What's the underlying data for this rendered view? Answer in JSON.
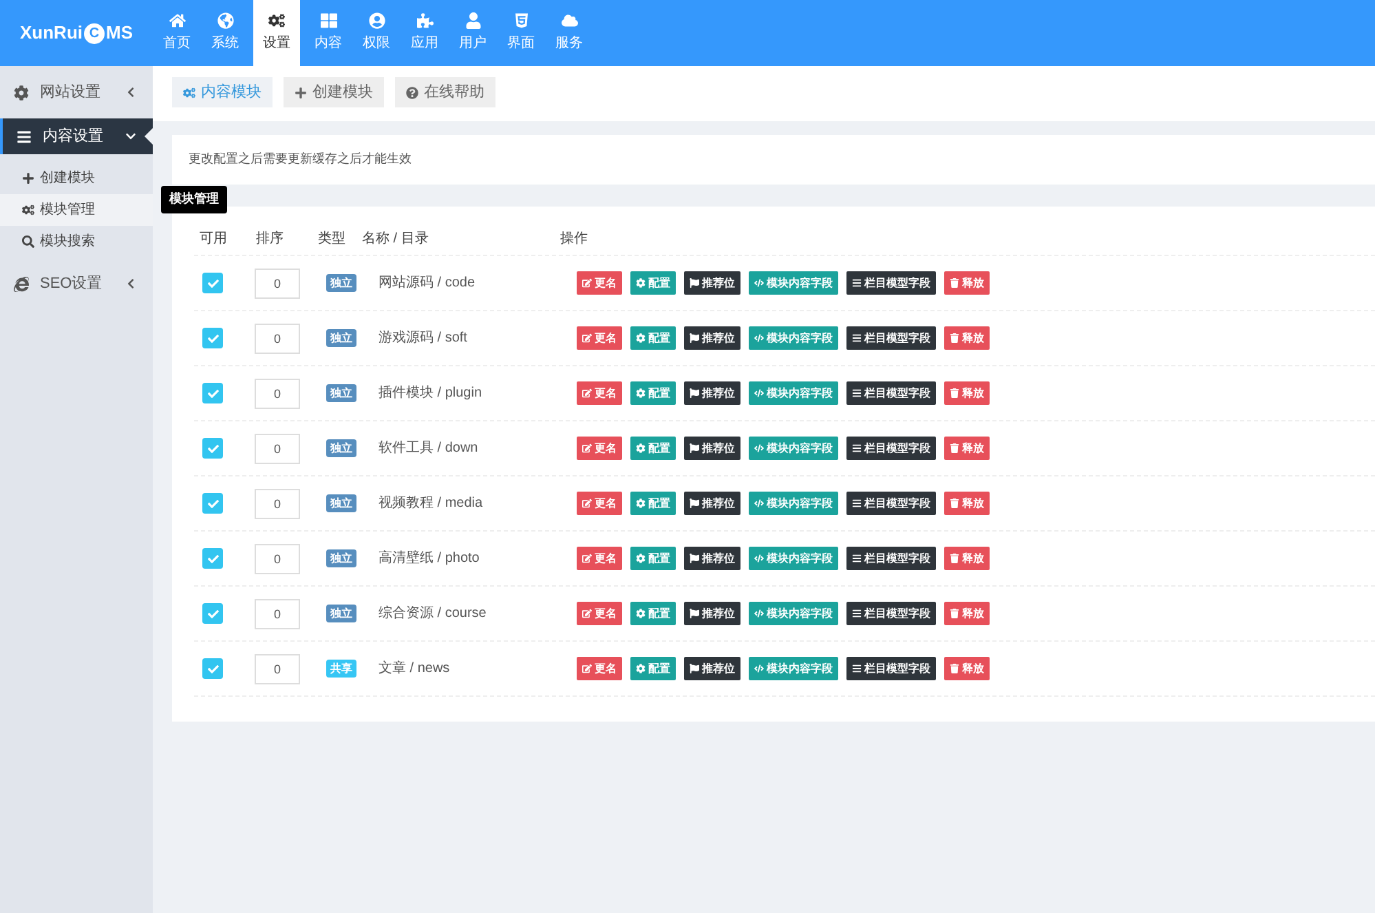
{
  "brand": {
    "name_before": "XunRui",
    "name_mark": "C",
    "name_after": "MS"
  },
  "nav": [
    {
      "label": "首页",
      "selected": false
    },
    {
      "label": "系统",
      "selected": false
    },
    {
      "label": "设置",
      "selected": true
    },
    {
      "label": "内容",
      "selected": false
    },
    {
      "label": "权限",
      "selected": false
    },
    {
      "label": "应用",
      "selected": false
    },
    {
      "label": "用户",
      "selected": false
    },
    {
      "label": "界面",
      "selected": false
    },
    {
      "label": "服务",
      "selected": false
    }
  ],
  "sidebar": {
    "items": [
      {
        "label": "网站设置",
        "expanded": false,
        "selected": false
      },
      {
        "label": "内容设置",
        "expanded": true,
        "selected": true,
        "children": [
          {
            "label": "创建模块",
            "selected": false
          },
          {
            "label": "模块管理",
            "selected": true
          },
          {
            "label": "模块搜索",
            "selected": false
          }
        ]
      },
      {
        "label": "SEO设置",
        "expanded": false,
        "selected": false
      }
    ]
  },
  "tooltip": "模块管理",
  "toolbar": [
    {
      "label": "内容模块",
      "selected": true
    },
    {
      "label": "创建模块",
      "selected": false
    },
    {
      "label": "在线帮助",
      "selected": false
    }
  ],
  "notice": "更改配置之后需要更新缓存之后才能生效",
  "table": {
    "columns": [
      "可用",
      "排序",
      "类型",
      "名称 / 目录",
      "操作"
    ],
    "rows": [
      {
        "checked": true,
        "order": "0",
        "type": "独立",
        "kind": "independent",
        "name": "网站源码 / code",
        "actions": [
          {
            "label": "更名",
            "kind": "rename"
          },
          {
            "label": "配置",
            "kind": "config"
          },
          {
            "label": "推荐位",
            "kind": "flag"
          },
          {
            "label": "模块内容字段",
            "kind": "code"
          },
          {
            "label": "栏目模型字段",
            "kind": "list"
          },
          {
            "label": "释放",
            "kind": "delete"
          }
        ]
      },
      {
        "checked": true,
        "order": "0",
        "type": "独立",
        "kind": "independent",
        "name": "游戏源码 / soft",
        "actions": [
          {
            "label": "更名",
            "kind": "rename"
          },
          {
            "label": "配置",
            "kind": "config"
          },
          {
            "label": "推荐位",
            "kind": "flag"
          },
          {
            "label": "模块内容字段",
            "kind": "code"
          },
          {
            "label": "栏目模型字段",
            "kind": "list"
          },
          {
            "label": "释放",
            "kind": "delete"
          }
        ]
      },
      {
        "checked": true,
        "order": "0",
        "type": "独立",
        "kind": "independent",
        "name": "插件模块 / plugin",
        "actions": [
          {
            "label": "更名",
            "kind": "rename"
          },
          {
            "label": "配置",
            "kind": "config"
          },
          {
            "label": "推荐位",
            "kind": "flag"
          },
          {
            "label": "模块内容字段",
            "kind": "code"
          },
          {
            "label": "栏目模型字段",
            "kind": "list"
          },
          {
            "label": "释放",
            "kind": "delete"
          }
        ]
      },
      {
        "checked": true,
        "order": "0",
        "type": "独立",
        "kind": "independent",
        "name": "软件工具 / down",
        "actions": [
          {
            "label": "更名",
            "kind": "rename"
          },
          {
            "label": "配置",
            "kind": "config"
          },
          {
            "label": "推荐位",
            "kind": "flag"
          },
          {
            "label": "模块内容字段",
            "kind": "code"
          },
          {
            "label": "栏目模型字段",
            "kind": "list"
          },
          {
            "label": "释放",
            "kind": "delete"
          }
        ]
      },
      {
        "checked": true,
        "order": "0",
        "type": "独立",
        "kind": "independent",
        "name": "视频教程 / media",
        "actions": [
          {
            "label": "更名",
            "kind": "rename"
          },
          {
            "label": "配置",
            "kind": "config"
          },
          {
            "label": "推荐位",
            "kind": "flag"
          },
          {
            "label": "模块内容字段",
            "kind": "code"
          },
          {
            "label": "栏目模型字段",
            "kind": "list"
          },
          {
            "label": "释放",
            "kind": "delete"
          }
        ]
      },
      {
        "checked": true,
        "order": "0",
        "type": "独立",
        "kind": "independent",
        "name": "高清壁纸 / photo",
        "actions": [
          {
            "label": "更名",
            "kind": "rename"
          },
          {
            "label": "配置",
            "kind": "config"
          },
          {
            "label": "推荐位",
            "kind": "flag"
          },
          {
            "label": "模块内容字段",
            "kind": "code"
          },
          {
            "label": "栏目模型字段",
            "kind": "list"
          },
          {
            "label": "释放",
            "kind": "delete"
          }
        ]
      },
      {
        "checked": true,
        "order": "0",
        "type": "独立",
        "kind": "independent",
        "name": "综合资源 / course",
        "actions": [
          {
            "label": "更名",
            "kind": "rename"
          },
          {
            "label": "配置",
            "kind": "config"
          },
          {
            "label": "推荐位",
            "kind": "flag"
          },
          {
            "label": "模块内容字段",
            "kind": "code"
          },
          {
            "label": "栏目模型字段",
            "kind": "list"
          },
          {
            "label": "释放",
            "kind": "delete"
          }
        ]
      },
      {
        "checked": true,
        "order": "0",
        "type": "共享",
        "kind": "shared",
        "name": "文章 / news",
        "actions": [
          {
            "label": "更名",
            "kind": "rename"
          },
          {
            "label": "配置",
            "kind": "config"
          },
          {
            "label": "推荐位",
            "kind": "flag"
          },
          {
            "label": "模块内容字段",
            "kind": "code"
          },
          {
            "label": "栏目模型字段",
            "kind": "list"
          },
          {
            "label": "释放",
            "kind": "delete"
          }
        ]
      }
    ]
  }
}
